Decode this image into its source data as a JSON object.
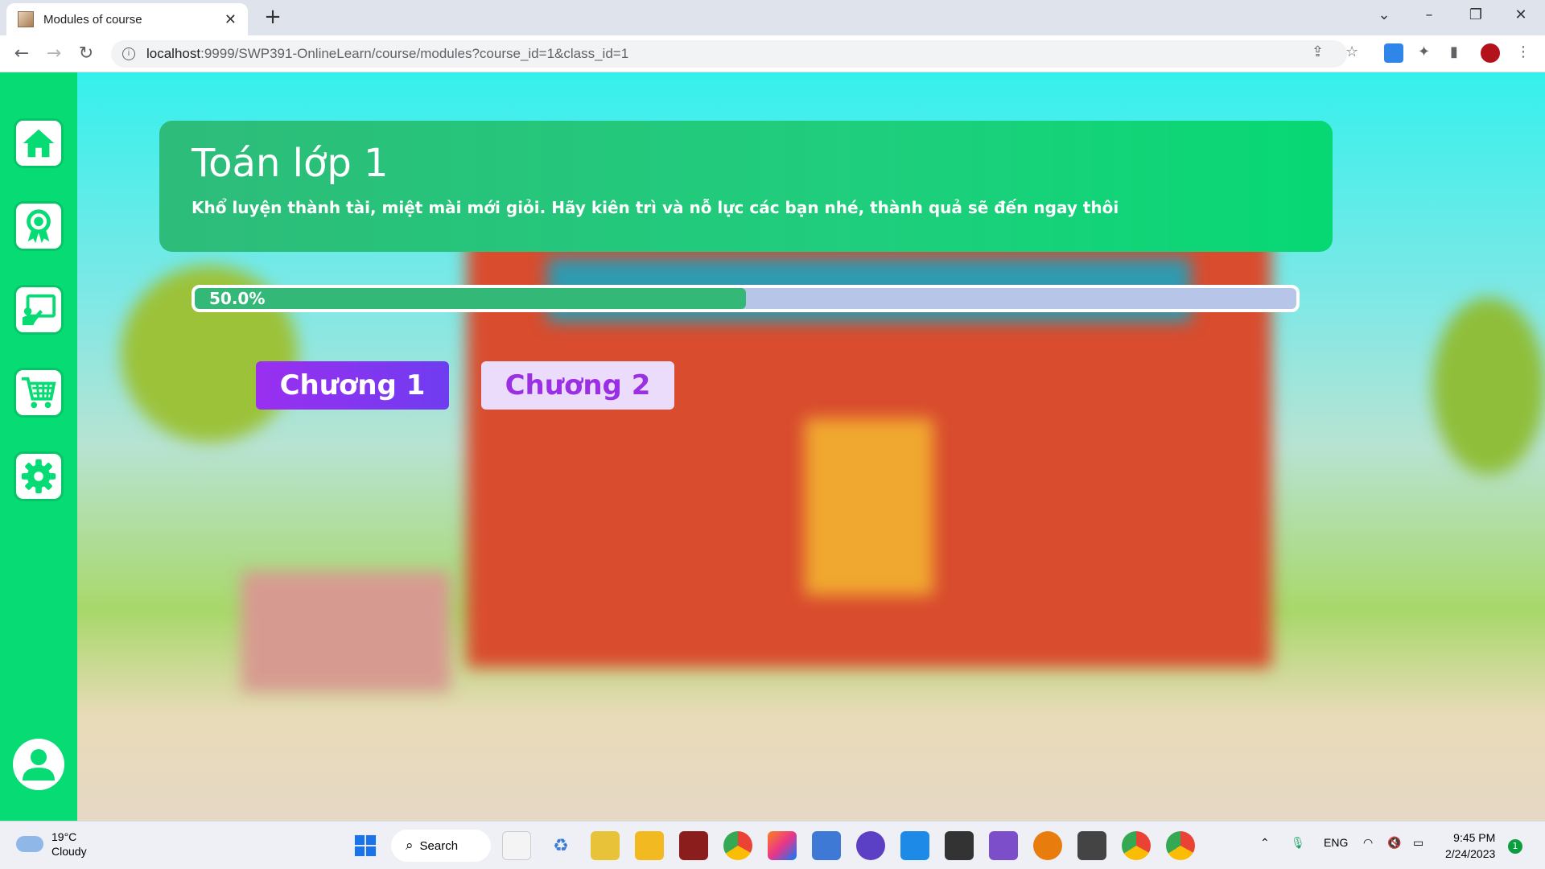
{
  "browser": {
    "tab_title": "Modules of course",
    "url_host": "localhost",
    "url_rest": ":9999/SWP391-OnlineLearn/course/modules?course_id=1&class_id=1"
  },
  "sidebar": {
    "items": [
      {
        "icon": "home-icon"
      },
      {
        "icon": "award-icon"
      },
      {
        "icon": "classroom-icon"
      },
      {
        "icon": "cart-icon"
      },
      {
        "icon": "settings-icon"
      }
    ],
    "profile_icon": "user-icon"
  },
  "course": {
    "title": "Toán lớp 1",
    "subtitle": "Khổ luyện thành tài, miệt mài mới giỏi. Hãy kiên trì và nỗ lực các bạn nhé, thành quả sẽ đến ngay thôi",
    "progress_text": "50.0%",
    "progress_value": 0.5,
    "modules": [
      {
        "label": "Chương 1",
        "active": true
      },
      {
        "label": "Chương 2",
        "active": false
      }
    ]
  },
  "colors": {
    "sidebar": "#06dc73",
    "banner": "#1fce7c",
    "progress_fill": "#33b878",
    "progress_track": "#b7c6e8",
    "module_active": "#7f35f0",
    "module_inactive": "#ecdcfb"
  },
  "taskbar": {
    "weather_temp": "19°C",
    "weather_desc": "Cloudy",
    "search_label": "Search",
    "lang": "ENG",
    "time": "9:45 PM",
    "date": "2/24/2023",
    "notifications": "1"
  }
}
